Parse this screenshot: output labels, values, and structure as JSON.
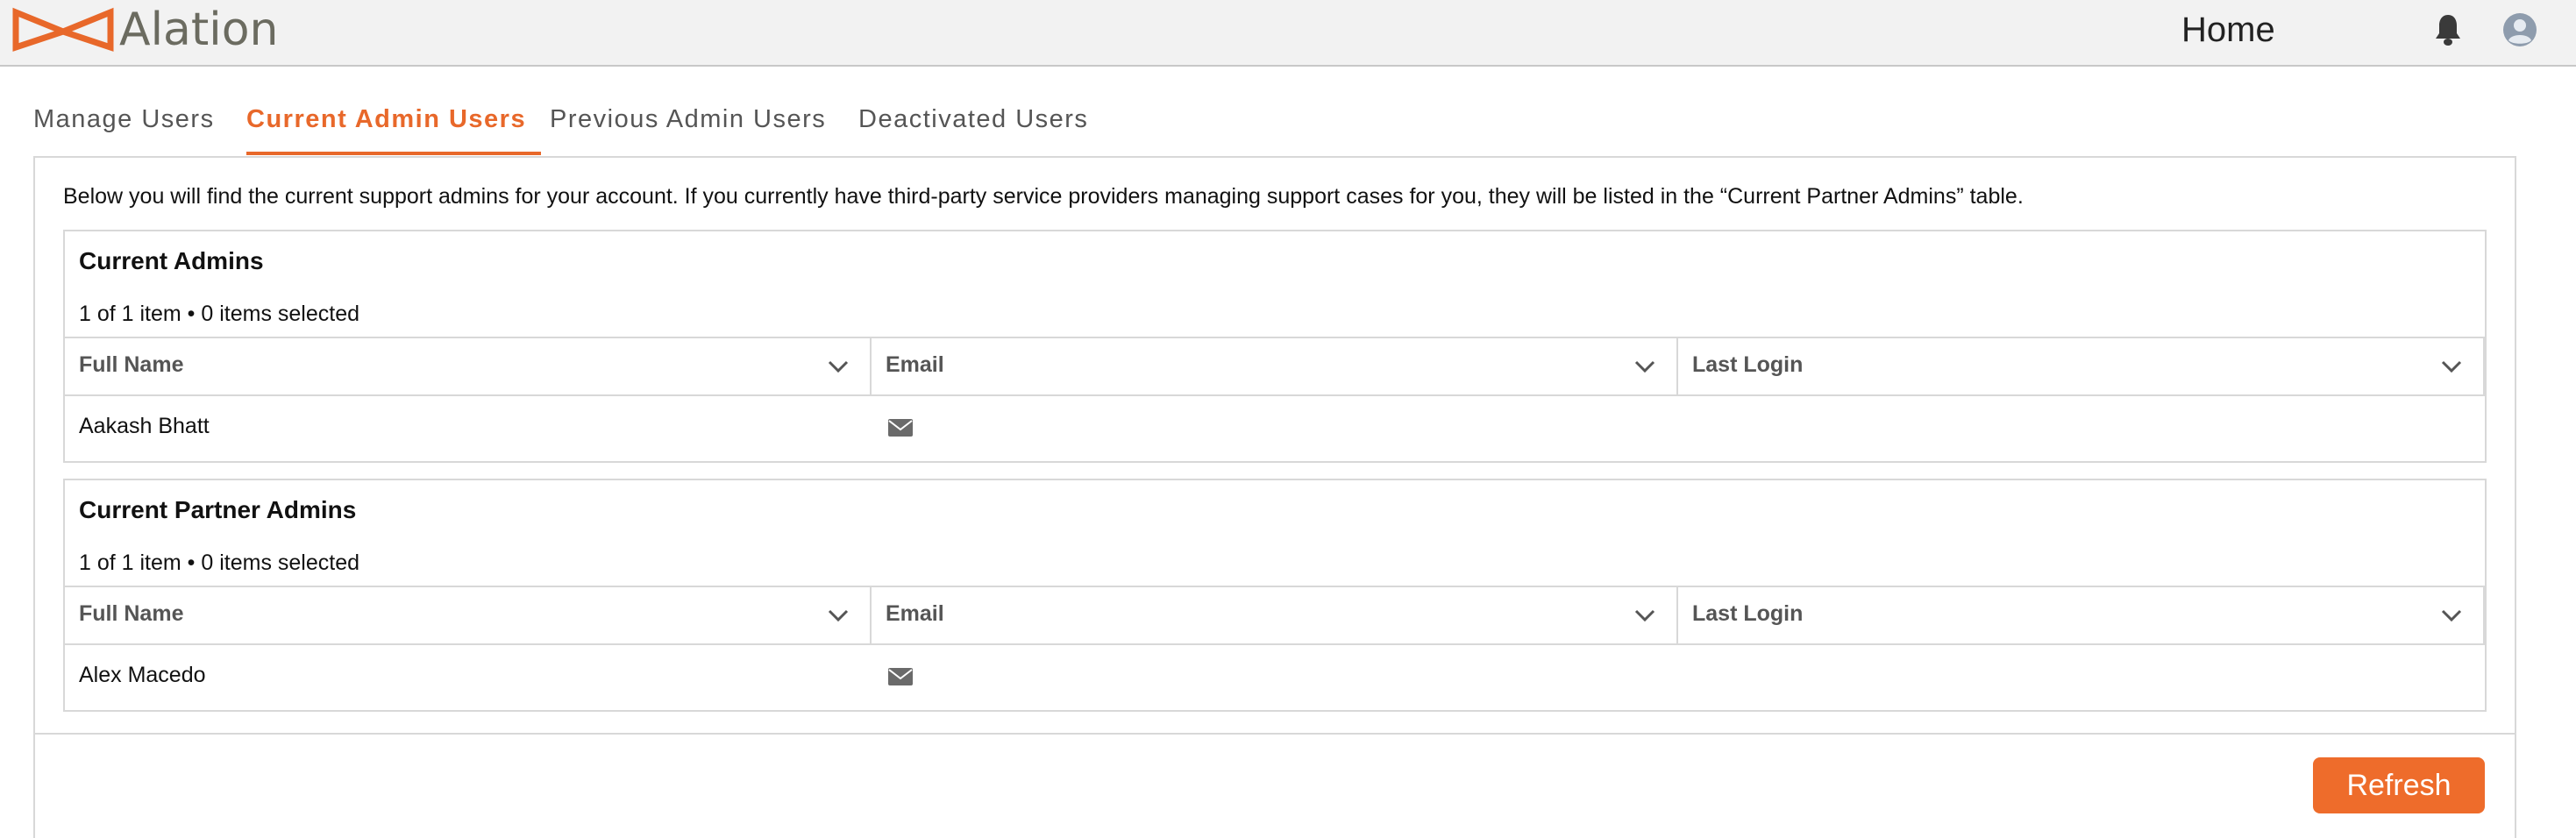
{
  "header": {
    "logo_text": "Alation",
    "home_label": "Home",
    "bell_icon": "bell-icon",
    "avatar_icon": "user-avatar-icon",
    "brand_color": "#e8682a"
  },
  "tabs": [
    {
      "label": "Manage Users",
      "active": false
    },
    {
      "label": "Current Admin Users",
      "active": true
    },
    {
      "label": "Previous Admin Users",
      "active": false
    },
    {
      "label": "Deactivated Users",
      "active": false
    }
  ],
  "intro_text": "Below you will find the current support admins for your account. If you currently have third-party service providers managing support cases for you, they will be listed in the “Current Partner Admins” table.",
  "current_admins": {
    "title": "Current Admins",
    "count": "1 of 1 item • 0 items selected",
    "columns": [
      "Full Name",
      "Email",
      "Last Login"
    ],
    "rows": [
      {
        "full_name": "Aakash Bhatt",
        "email_icon": "envelope-icon",
        "last_login": ""
      }
    ]
  },
  "partner_admins": {
    "title": "Current Partner Admins",
    "count": "1 of 1 item • 0 items selected",
    "columns": [
      "Full Name",
      "Email",
      "Last Login"
    ],
    "rows": [
      {
        "full_name": "Alex Macedo",
        "email_icon": "envelope-icon",
        "last_login": ""
      }
    ]
  },
  "refresh_label": "Refresh"
}
